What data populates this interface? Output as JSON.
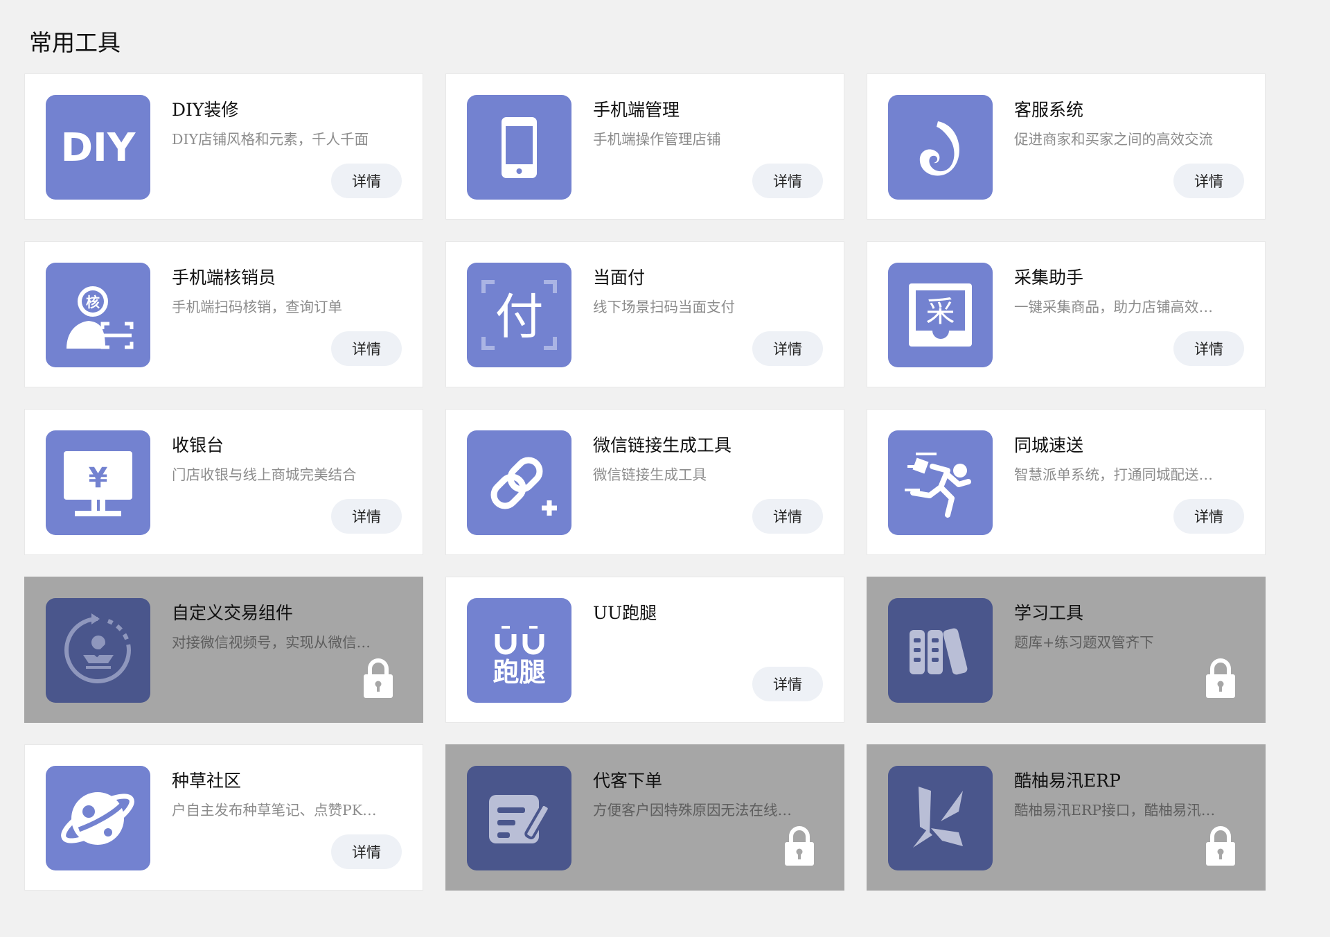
{
  "page": {
    "title": "常用工具"
  },
  "colors": {
    "background": "#f1f1f1",
    "icon_bg": "#7382d0",
    "icon_bg_locked": "#4a568c",
    "card_locked_bg": "#a6a6a6",
    "detail_button_bg": "#eef1f6"
  },
  "tools": [
    {
      "title": "DIY装修",
      "desc": "DIY店铺风格和元素，千人千面",
      "button": "详情",
      "icon": "diy-icon",
      "icon_text": "DIY",
      "locked": false
    },
    {
      "title": "手机端管理",
      "desc": "手机端操作管理店铺",
      "button": "详情",
      "icon": "phone-icon",
      "locked": false
    },
    {
      "title": "客服系统",
      "desc": "促进商家和买家之间的高效交流",
      "button": "详情",
      "icon": "customer-service-icon",
      "locked": false
    },
    {
      "title": "手机端核销员",
      "desc": "手机端扫码核销，查询订单",
      "button": "详情",
      "icon": "verifier-icon",
      "icon_text": "核",
      "locked": false
    },
    {
      "title": "当面付",
      "desc": "线下场景扫码当面支付",
      "button": "详情",
      "icon": "face-pay-icon",
      "icon_text": "付",
      "locked": false
    },
    {
      "title": "采集助手",
      "desc": "一键采集商品，助力店铺高效…",
      "button": "详情",
      "icon": "collect-icon",
      "icon_text": "采",
      "locked": false
    },
    {
      "title": "收银台",
      "desc": "门店收银与线上商城完美结合",
      "button": "详情",
      "icon": "cashier-icon",
      "icon_text": "¥",
      "locked": false
    },
    {
      "title": "微信链接生成工具",
      "desc": "微信链接生成工具",
      "button": "详情",
      "icon": "link-icon",
      "locked": false
    },
    {
      "title": "同城速送",
      "desc": "智慧派单系统，打通同城配送…",
      "button": "详情",
      "icon": "runner-icon",
      "locked": false
    },
    {
      "title": "自定义交易组件",
      "desc": "对接微信视频号，实现从微信…",
      "button": "",
      "icon": "trade-component-icon",
      "locked": true
    },
    {
      "title": "UU跑腿",
      "desc": "",
      "button": "详情",
      "icon": "uu-icon",
      "icon_text": "UU",
      "icon_text2": "跑腿",
      "locked": false
    },
    {
      "title": "学习工具",
      "desc": "题库+练习题双管齐下",
      "button": "",
      "icon": "books-icon",
      "locked": true
    },
    {
      "title": "种草社区",
      "desc": "户自主发布种草笔记、点赞PK…",
      "button": "详情",
      "icon": "planet-icon",
      "locked": false
    },
    {
      "title": "代客下单",
      "desc": "方便客户因特殊原因无法在线…",
      "button": "",
      "icon": "edit-note-icon",
      "locked": true
    },
    {
      "title": "酷柚易汛ERP",
      "desc": "酷柚易汛ERP接口，酷柚易汛…",
      "button": "",
      "icon": "erp-logo-icon",
      "locked": true
    }
  ]
}
